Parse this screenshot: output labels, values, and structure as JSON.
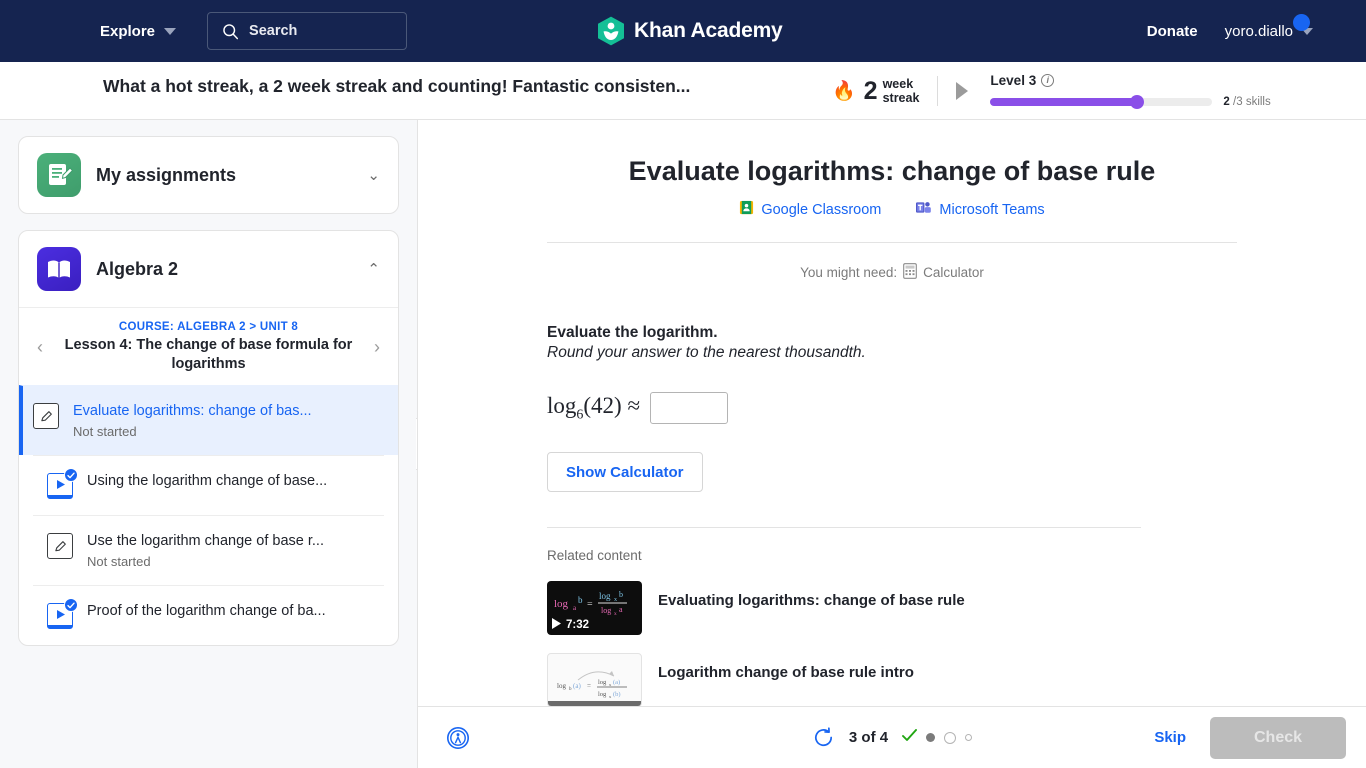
{
  "topnav": {
    "explore_label": "Explore",
    "search_placeholder": "Search",
    "brand": "Khan Academy",
    "donate_label": "Donate",
    "user_name": "yoro.diallo",
    "icons": {
      "search": "search-icon",
      "caret": "chevron-down-icon",
      "logo": "khan-academy-logo"
    },
    "colors": {
      "nav_bg": "#152450",
      "brand_green": "#14bf96",
      "accent_blue": "#1865f2"
    }
  },
  "streakbar": {
    "message": "What a hot streak, a 2 week streak and counting! Fantastic consisten...",
    "flame_icon": "flame-icon",
    "streak_count": "2",
    "streak_word_top": "week",
    "streak_word_bottom": "streak",
    "level_label": "Level 3",
    "info_icon": "info-icon",
    "progress_percent": 66,
    "skills_done": "2",
    "skills_total": "/3 skills",
    "progress_color": "#8a4fe8"
  },
  "sidebar": {
    "assignments": {
      "title": "My assignments",
      "icon": "clipboard-pencil-icon",
      "chevron": "chevron-down-icon"
    },
    "course": {
      "title": "Algebra 2",
      "icon": "book-icon",
      "chevron": "chevron-up-icon"
    },
    "breadcrumb_course": "COURSE: ALGEBRA 2",
    "breadcrumb_sep": ">",
    "breadcrumb_unit": "UNIT 8",
    "lesson_title": "Lesson 4: The change of base formula for logarithms",
    "prev_icon": "chevron-left-icon",
    "next_icon": "chevron-right-icon",
    "items": [
      {
        "title": "Evaluate logarithms: change of bas...",
        "status": "Not started",
        "type": "exercise",
        "active": true,
        "completed": false
      },
      {
        "title": "Using the logarithm change of base...",
        "status": "",
        "type": "video",
        "active": false,
        "completed": true
      },
      {
        "title": "Use the logarithm change of base r...",
        "status": "Not started",
        "type": "exercise",
        "active": false,
        "completed": false
      },
      {
        "title": "Proof of the logarithm change of ba...",
        "status": "",
        "type": "video",
        "active": false,
        "completed": true
      }
    ],
    "collapse_icon": "chevron-left-icon"
  },
  "main": {
    "exercise_title": "Evaluate logarithms: change of base rule",
    "links": [
      {
        "label": "Google Classroom",
        "icon": "google-classroom-icon"
      },
      {
        "label": "Microsoft Teams",
        "icon": "microsoft-teams-icon"
      }
    ],
    "you_might_need": "You might need:",
    "calculator_label": "Calculator",
    "calculator_icon": "calculator-icon",
    "question_prompt": "Evaluate the logarithm.",
    "question_sub": "Round your answer to the nearest thousandth.",
    "math": {
      "fn": "log",
      "base": "6",
      "arg": "(42)",
      "rel": "≈"
    },
    "answer_value": "",
    "answer_placeholder": "",
    "show_calculator_label": "Show Calculator",
    "related_label": "Related content",
    "related": [
      {
        "title": "Evaluating logarithms: change of base rule",
        "duration": "7:32",
        "thumb": "dark",
        "play_icon": "play-icon"
      },
      {
        "title": "Logarithm change of base rule intro",
        "duration": "",
        "thumb": "light",
        "play_icon": ""
      }
    ]
  },
  "bottombar": {
    "a11y_icon": "accessibility-icon",
    "refresh_icon": "refresh-icon",
    "progress_text": "3 of 4",
    "markers": [
      "check",
      "filled",
      "open",
      "small"
    ],
    "skip_label": "Skip",
    "check_label": "Check",
    "check_disabled": true
  }
}
